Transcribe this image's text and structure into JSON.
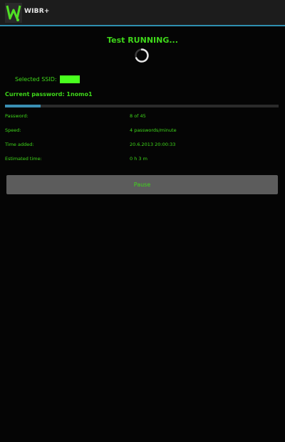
{
  "app_bar": {
    "title": "WIBR+",
    "logo_icon": "wibr-logo-icon"
  },
  "status": {
    "title": "Test RUNNING..."
  },
  "ssid": {
    "label": "Selected SSID:",
    "value": "",
    "highlight_color": "#49ff1e"
  },
  "current_password": {
    "text": "Current password: 1nomo1"
  },
  "progress": {
    "fraction": 0.13,
    "color": "#3a8fb3"
  },
  "info": {
    "password_label": "Password:",
    "password_value": "8 of 45",
    "speed_label": "Speed:",
    "speed_value": "4 passwords/minute",
    "time_label": "Time added:",
    "time_value": "20.6.2013 20:00:33",
    "estimated_label": "Estimated time:",
    "estimated_value": "0 h 3 m"
  },
  "pause_button": {
    "label": "Pause"
  },
  "colors": {
    "text_green": "#3fd81a",
    "accent_blue": "#2f8fb0",
    "button_gray": "#5c5c5c"
  }
}
